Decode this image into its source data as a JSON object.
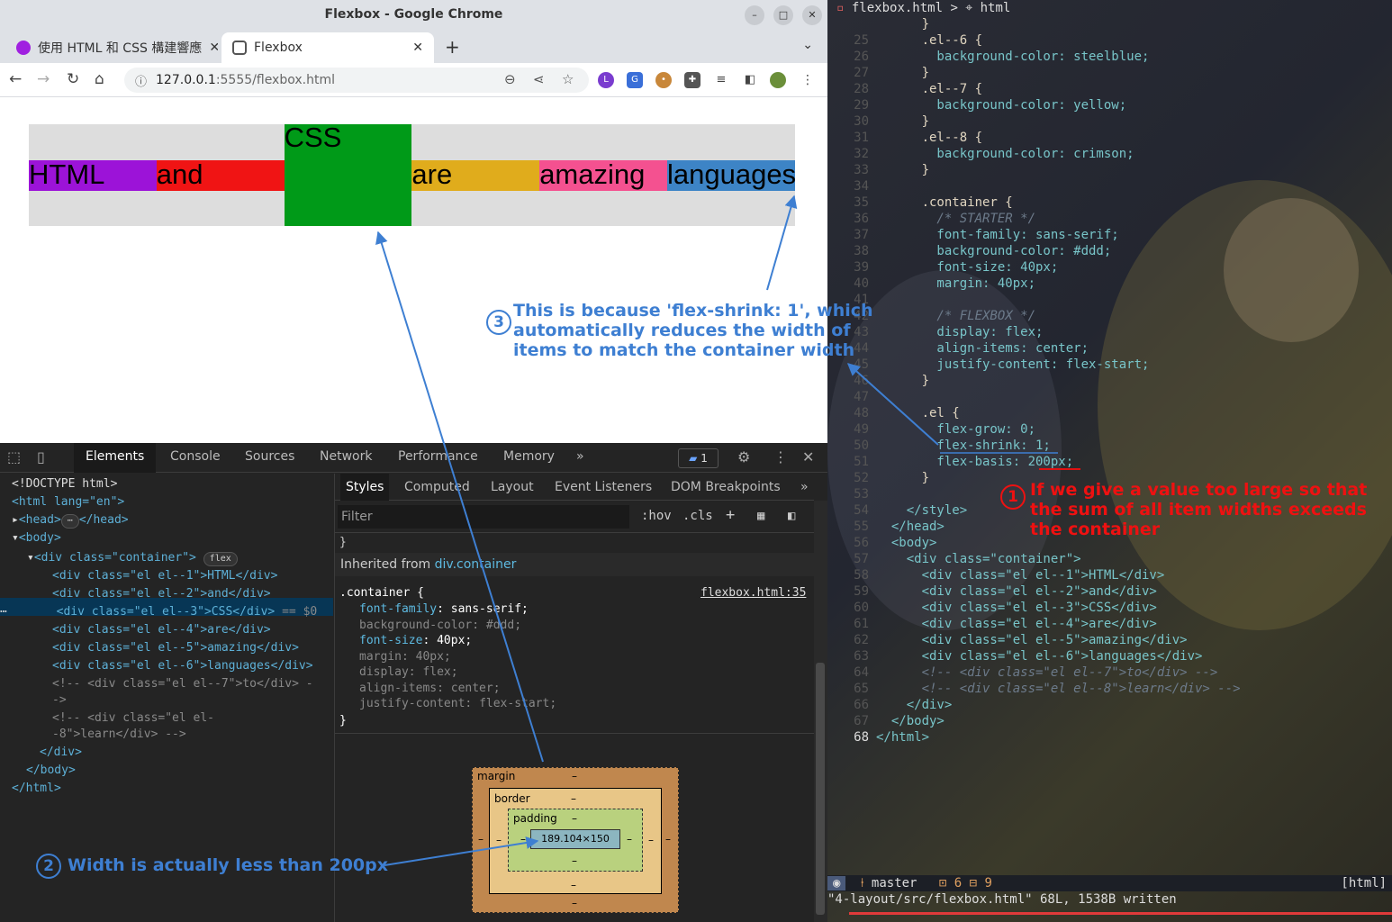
{
  "browser": {
    "window_title": "Flexbox - Google Chrome",
    "tabs": [
      {
        "title": "使用 HTML 和 CSS 構建響應",
        "active": false
      },
      {
        "title": "Flexbox",
        "active": true
      }
    ],
    "url_host": "127.0.0.1",
    "url_rest": ":5555/flexbox.html"
  },
  "page": {
    "items": [
      "HTML",
      "and",
      "CSS",
      "are",
      "amazing",
      "languages"
    ],
    "colors": [
      "#9c13d8",
      "#f01414",
      "#009a18",
      "#e0ac1c",
      "#f45190",
      "#3d84c6"
    ],
    "container_bg": "#dddddd"
  },
  "devtools": {
    "main_tabs": [
      "Elements",
      "Console",
      "Sources",
      "Network",
      "Performance",
      "Memory"
    ],
    "issues_count": "1",
    "dom_lines": [
      "<!DOCTYPE html>",
      "<html lang=\"en\">",
      "<head>",
      "<body>",
      "<div class=\"container\">",
      "<div class=\"el el--1\">HTML</div>",
      "<div class=\"el el--2\">and</div>",
      "<div class=\"el el--3\">CSS</div>",
      "<div class=\"el el--4\">are</div>",
      "<div class=\"el el--5\">amazing</div>",
      "<div class=\"el el--6\">languages</div>",
      "<!-- <div class=\"el el--7\">to</div> -",
      "->",
      "<!-- <div class=\"el el-",
      "-8\">learn</div> -->",
      "</div>",
      "</body>",
      "</html>"
    ],
    "flex_badge": "flex",
    "selected_suffix": "== $0",
    "style_tabs": [
      "Styles",
      "Computed",
      "Layout",
      "Event Listeners",
      "DOM Breakpoints"
    ],
    "filter_placeholder": "Filter",
    "hov": ":hov",
    "cls": ".cls",
    "inherited_label": "Inherited from",
    "inherited_from": "div.container",
    "rule_selector": ".container {",
    "rule_source": "flexbox.html:35",
    "rule_props": [
      {
        "name": "font-family",
        "value": "sans-serif;",
        "active": true
      },
      {
        "name": "background-color",
        "value": "#ddd;",
        "active": false
      },
      {
        "name": "font-size",
        "value": "40px;",
        "active": true
      },
      {
        "name": "margin",
        "value": "40px;",
        "active": false
      },
      {
        "name": "display",
        "value": "flex;",
        "active": false
      },
      {
        "name": "align-items",
        "value": "center;",
        "active": false
      },
      {
        "name": "justify-content",
        "value": "flex-start;",
        "active": false
      }
    ],
    "box_model": {
      "margin_label": "margin",
      "border_label": "border",
      "padding_label": "padding",
      "dash": "–",
      "content_size": "189.104×150"
    }
  },
  "editor": {
    "breadcrumb": "flexbox.html > ⌖ html",
    "lines": [
      {
        "n": "",
        "t": "      }"
      },
      {
        "n": "25",
        "t": "      .el--6 {"
      },
      {
        "n": "26",
        "t": "        background-color: steelblue;"
      },
      {
        "n": "27",
        "t": "      }"
      },
      {
        "n": "28",
        "t": "      .el--7 {"
      },
      {
        "n": "29",
        "t": "        background-color: yellow;"
      },
      {
        "n": "30",
        "t": "      }"
      },
      {
        "n": "31",
        "t": "      .el--8 {"
      },
      {
        "n": "32",
        "t": "        background-color: crimson;"
      },
      {
        "n": "33",
        "t": "      }"
      },
      {
        "n": "34",
        "t": ""
      },
      {
        "n": "35",
        "t": "      .container {"
      },
      {
        "n": "36",
        "t": "        /* STARTER */"
      },
      {
        "n": "37",
        "t": "        font-family: sans-serif;"
      },
      {
        "n": "38",
        "t": "        background-color: #ddd;"
      },
      {
        "n": "39",
        "t": "        font-size: 40px;"
      },
      {
        "n": "40",
        "t": "        margin: 40px;"
      },
      {
        "n": "41",
        "t": ""
      },
      {
        "n": "42",
        "t": "        /* FLEXBOX */"
      },
      {
        "n": "43",
        "t": "        display: flex;"
      },
      {
        "n": "44",
        "t": "        align-items: center;"
      },
      {
        "n": "45",
        "t": "        justify-content: flex-start;"
      },
      {
        "n": "46",
        "t": "      }"
      },
      {
        "n": "47",
        "t": ""
      },
      {
        "n": "48",
        "t": "      .el {"
      },
      {
        "n": "49",
        "t": "        flex-grow: 0;"
      },
      {
        "n": "50",
        "t": "        flex-shrink: 1;"
      },
      {
        "n": "51",
        "t": "        flex-basis: 200px;"
      },
      {
        "n": "52",
        "t": "      }"
      },
      {
        "n": "53",
        "t": ""
      },
      {
        "n": "54",
        "t": "    </style>"
      },
      {
        "n": "55",
        "t": "  </head>"
      },
      {
        "n": "56",
        "t": "  <body>"
      },
      {
        "n": "57",
        "t": "    <div class=\"container\">"
      },
      {
        "n": "58",
        "t": "      <div class=\"el el--1\">HTML</div>"
      },
      {
        "n": "59",
        "t": "      <div class=\"el el--2\">and</div>"
      },
      {
        "n": "60",
        "t": "      <div class=\"el el--3\">CSS</div>"
      },
      {
        "n": "61",
        "t": "      <div class=\"el el--4\">are</div>"
      },
      {
        "n": "62",
        "t": "      <div class=\"el el--5\">amazing</div>"
      },
      {
        "n": "63",
        "t": "      <div class=\"el el--6\">languages</div>"
      },
      {
        "n": "64",
        "t": "      <!-- <div class=\"el el--7\">to</div> -->"
      },
      {
        "n": "65",
        "t": "      <!-- <div class=\"el el--8\">learn</div> -->"
      },
      {
        "n": "66",
        "t": "    </div>"
      },
      {
        "n": "67",
        "t": "  </body>"
      },
      {
        "n": "68",
        "t": "</html>"
      }
    ],
    "status_mode": "◉",
    "status_branch": "master",
    "status_counts": "⊡ 6 ⊟ 9",
    "status_ft": "[html]",
    "cmdline": "\"4-layout/src/flexbox.html\" 68L, 1538B written"
  },
  "annotations": [
    {
      "num": "1",
      "text": [
        "If we give a value too large so that",
        "the sum of all item widths exceeds",
        "the container"
      ],
      "color": "#e11111"
    },
    {
      "num": "2",
      "text": [
        "Width is actually less than 200px"
      ],
      "color": "#3e7fd2"
    },
    {
      "num": "3",
      "text": [
        "This is because 'flex-shrink: 1', which",
        "automatically reduces the width of",
        "items to match the container width"
      ],
      "color": "#3e7fd2"
    }
  ]
}
